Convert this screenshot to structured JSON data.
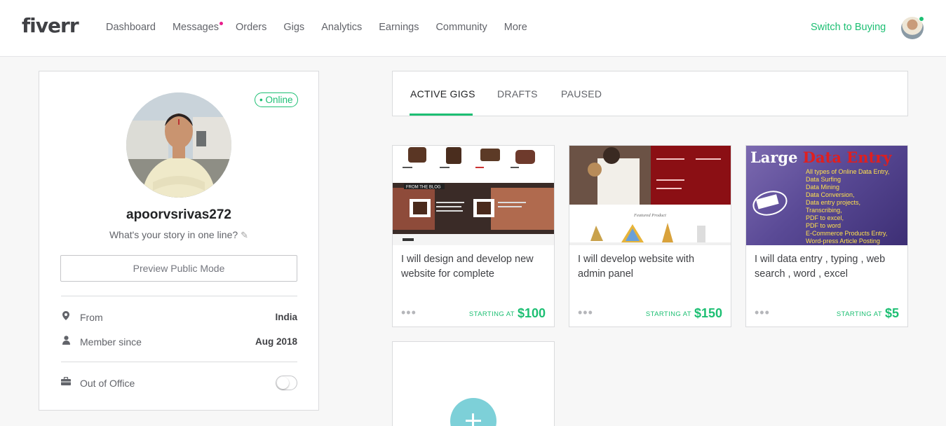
{
  "header": {
    "logo": "fiverr",
    "nav": [
      "Dashboard",
      "Messages",
      "Orders",
      "Gigs",
      "Analytics",
      "Earnings",
      "Community",
      "More"
    ],
    "switch_label": "Switch to Buying",
    "colors": {
      "accent": "#1dbf73",
      "notification": "#e91e8c"
    }
  },
  "profile": {
    "online_label": "• Online",
    "username": "apoorvsrivas272",
    "tagline": "What's your story in one line?",
    "preview_button": "Preview Public Mode",
    "from_label": "From",
    "from_value": "India",
    "member_label": "Member since",
    "member_value": "Aug 2018",
    "ooo_label": "Out of Office",
    "ooo_enabled": false
  },
  "tabs": {
    "items": [
      "ACTIVE GIGS",
      "DRAFTS",
      "PAUSED"
    ],
    "active": "ACTIVE GIGS"
  },
  "gigs": [
    {
      "title": "I will design and develop new website for complete",
      "starting_label": "STARTING AT",
      "price": "$100"
    },
    {
      "title": "I will develop website with admin panel",
      "starting_label": "STARTING AT",
      "price": "$150"
    },
    {
      "title": "I will data entry , typing , web search , word , excel",
      "starting_label": "STARTING AT",
      "price": "$5"
    }
  ],
  "gig_thumbnails": {
    "blog_label": "FROM THE BLOG",
    "featured_label": "Featured Product",
    "data_entry_title_1": "Large",
    "data_entry_title_2": "Data Entry",
    "data_entry_lines": [
      "All types of Online Data Entry,",
      "Data Surfing",
      "Data Mining",
      "Data Conversion,",
      "Data entry projects,",
      "Transcribing,",
      "PDF to excel,",
      "PDF to word",
      "E-Commerce Products Entry,",
      "Word-press Article Posting"
    ]
  }
}
